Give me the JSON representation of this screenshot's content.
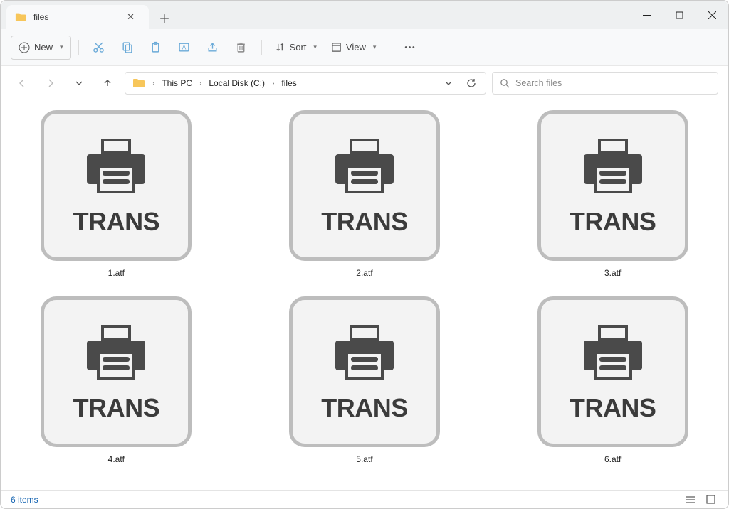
{
  "tab_title": "files",
  "toolbar": {
    "new_label": "New",
    "sort_label": "Sort",
    "view_label": "View"
  },
  "breadcrumbs": [
    "This PC",
    "Local Disk (C:)",
    "files"
  ],
  "search": {
    "placeholder": "Search files"
  },
  "file_icon_label": "TRANS",
  "files": [
    {
      "name": "1.atf"
    },
    {
      "name": "2.atf"
    },
    {
      "name": "3.atf"
    },
    {
      "name": "4.atf"
    },
    {
      "name": "5.atf"
    },
    {
      "name": "6.atf"
    }
  ],
  "status": {
    "count_label": "6 items"
  }
}
